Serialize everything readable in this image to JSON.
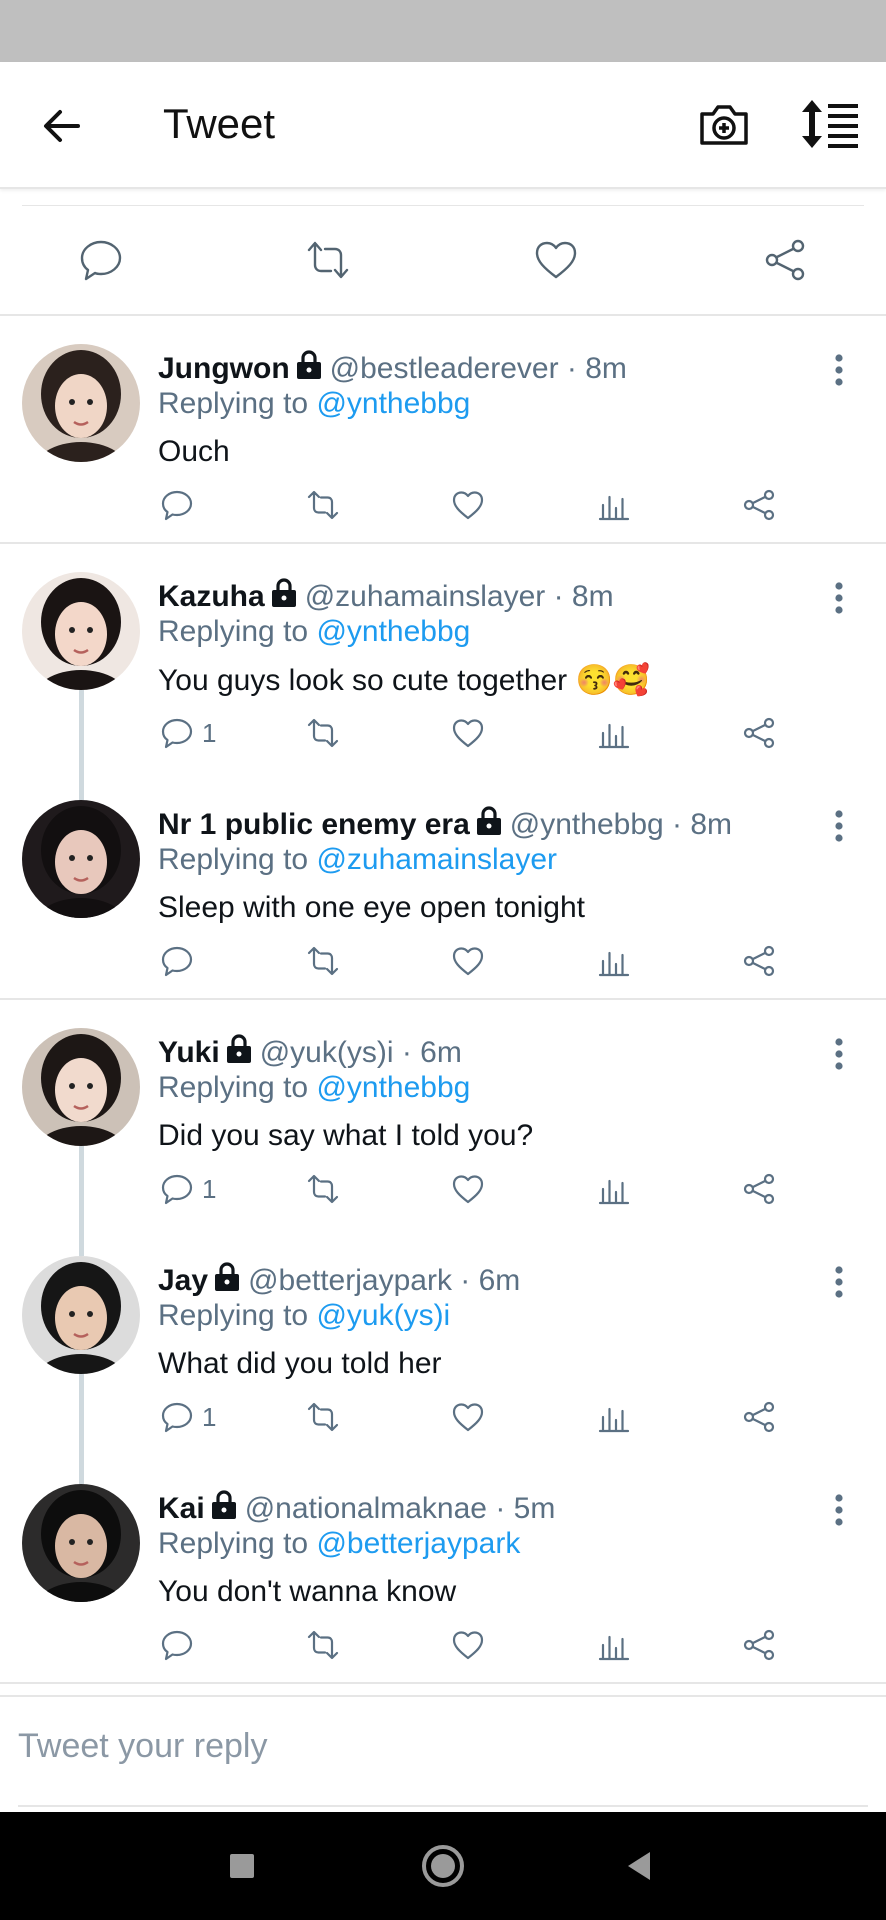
{
  "header": {
    "title": "Tweet",
    "back_icon": "arrow-left-icon",
    "camera_icon": "camera-add-icon",
    "sort_icon": "sort-icon"
  },
  "tweet_actions": [
    "reply-icon",
    "retweet-icon",
    "like-icon",
    "share-icon"
  ],
  "replies": [
    {
      "name": "Jungwon",
      "handle": "@bestleaderever",
      "time": "· 8m",
      "replying_to_label": "Replying to",
      "replying_to": "@ynthebbg",
      "text": "Ouch",
      "reply_count": ""
    },
    {
      "name": "Kazuha",
      "handle": "@zuhamainslayer",
      "time": "· 8m",
      "replying_to_label": "Replying to",
      "replying_to": "@ynthebbg",
      "text": "You guys look so cute together 😚🥰",
      "reply_count": "1"
    },
    {
      "name": "Nr 1 public enemy era",
      "handle": "@ynthebbg",
      "time": "· 8m",
      "replying_to_label": "Replying to",
      "replying_to": "@zuhamainslayer",
      "text": "Sleep with one eye open tonight",
      "reply_count": ""
    },
    {
      "name": "Yuki",
      "handle": "@yuk(ys)i",
      "time": "· 6m",
      "replying_to_label": "Replying to",
      "replying_to": "@ynthebbg",
      "text": "Did you say what I told you?",
      "reply_count": "1"
    },
    {
      "name": "Jay",
      "handle": "@betterjaypark",
      "time": "· 6m",
      "replying_to_label": "Replying to",
      "replying_to": "@yuk(ys)i",
      "text": "What did you told her",
      "reply_count": "1"
    },
    {
      "name": "Kai",
      "handle": "@nationalmaknae",
      "time": "· 5m",
      "replying_to_label": "Replying to",
      "replying_to": "@betterjaypark",
      "text": "You don't wanna know",
      "reply_count": ""
    }
  ],
  "compose": {
    "placeholder": "Tweet your reply"
  },
  "colors": {
    "accent": "#1d9bf0",
    "secondary_text": "#5b7083",
    "divider": "#e6e6e6",
    "status_bar": "#bfbfbf",
    "nav_bar": "#000000"
  }
}
